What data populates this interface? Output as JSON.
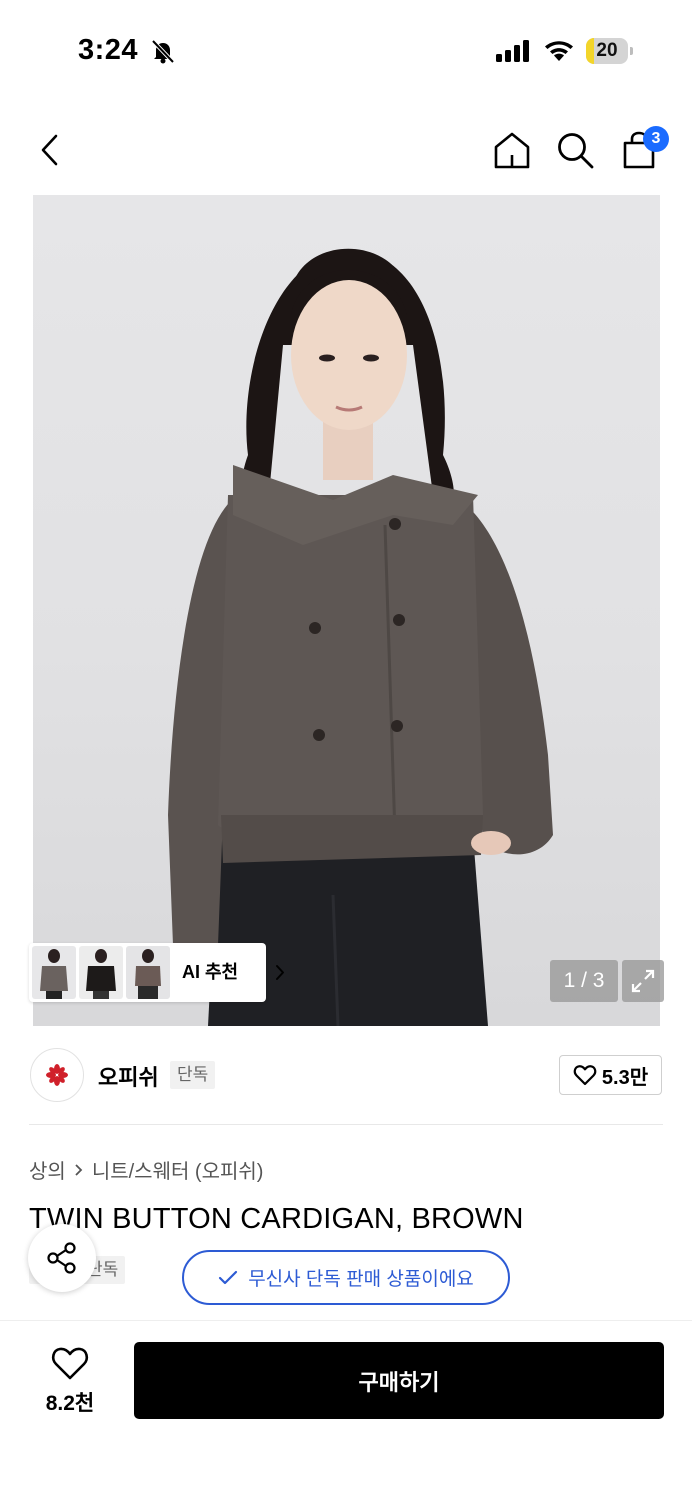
{
  "status_bar": {
    "time": "3:24",
    "battery_level": "20",
    "battery_fraction": 0.2,
    "icons": [
      "bell-slash-icon",
      "cellular-signal-icon",
      "wifi-icon",
      "battery-icon"
    ]
  },
  "nav": {
    "icons": [
      "chevron-left-icon",
      "home-icon",
      "search-icon",
      "shopping-bag-icon"
    ],
    "cart_count": "3"
  },
  "gallery": {
    "ai_label": "AI 추천",
    "page_indicator": "1 / 3",
    "icons": [
      "chevron-right-icon",
      "expand-icon"
    ]
  },
  "brand": {
    "name": "오피쉬",
    "tag": "단독",
    "like_count": "5.3만",
    "logo_color": "#d0202a",
    "icons": [
      "brand-logo-icon",
      "heart-outline-icon"
    ]
  },
  "product": {
    "breadcrumb": [
      "상의",
      "니트/스웨터 (오피쉬)"
    ],
    "title": "TWIN BUTTON CARDIGAN, BROWN",
    "tag": "단독",
    "exclusive_notice": "무신사 단독 판매 상품이에요",
    "icons": [
      "share-icon",
      "check-icon"
    ]
  },
  "bottom_bar": {
    "wish_count": "8.2천",
    "buy_label": "구매하기",
    "icons": [
      "heart-outline-icon"
    ]
  },
  "colors": {
    "accent_blue": "#2d5bd4",
    "badge_blue": "#1a6bff",
    "battery_yellow": "#f3d52a",
    "garment_brown": "#5a5350"
  }
}
